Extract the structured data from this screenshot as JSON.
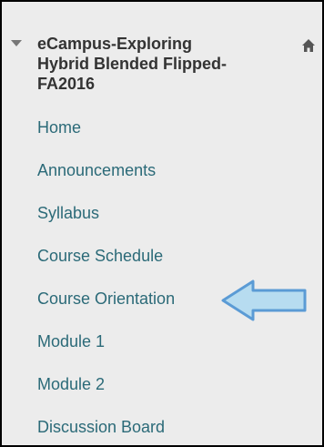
{
  "course": {
    "title_line1": "eCampus-Exploring",
    "title_line2": "Hybrid Blended Flipped-",
    "title_line3": "FA2016",
    "collapse_icon": "triangle-down-icon",
    "home_icon": "home-icon"
  },
  "menu": {
    "items": [
      {
        "label": "Home"
      },
      {
        "label": "Announcements"
      },
      {
        "label": "Syllabus"
      },
      {
        "label": "Course Schedule"
      },
      {
        "label": "Course Orientation",
        "highlighted": true
      },
      {
        "label": "Module 1"
      },
      {
        "label": "Module 2"
      },
      {
        "label": "Discussion Board"
      }
    ]
  },
  "colors": {
    "link": "#2b6a78",
    "background": "#ececec",
    "arrow_fill": "#b7dcf0",
    "arrow_stroke": "#5b9bd5"
  }
}
